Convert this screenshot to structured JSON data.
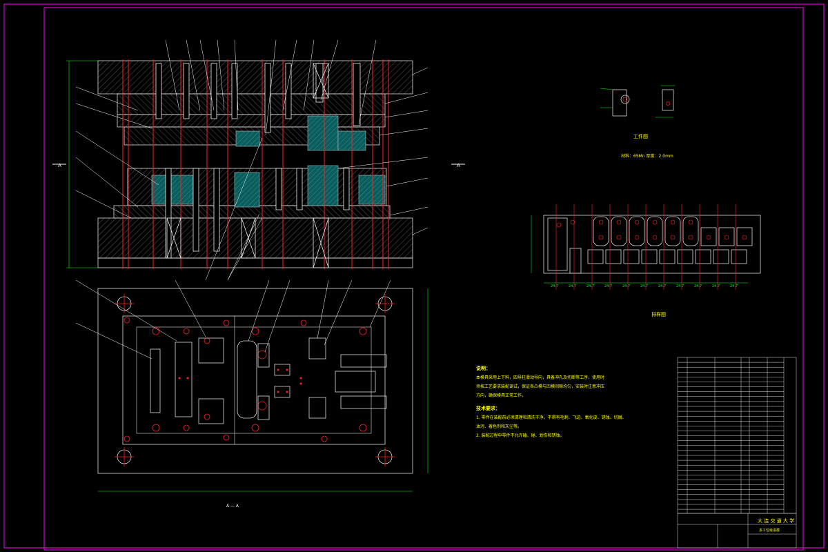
{
  "drawing": {
    "workpiece_caption": "工件图",
    "material_caption": "材料：65Mn  厚度：2.0mm",
    "strip_caption": "排样图",
    "pitch_labels": [
      "24.7",
      "24.7",
      "24.7",
      "24.7",
      "24.7",
      "24.7",
      "24.7",
      "24.7",
      "24.7",
      "24.7",
      "24.7"
    ],
    "main_view_label": "A — A",
    "section_mark_left": "A",
    "section_mark_right": "A"
  },
  "notes": {
    "desc_title": "说明：",
    "desc_line1": "本模具采用上下料，四导柱滑动导向，具备冲孔及切断等工序，使用时",
    "desc_line2": "须按工艺要求装配调试，保证各凸模与凹模间隙均匀，安装时注意冲压",
    "desc_line3": "方向，确保模具正常工作。",
    "tech_title": "技术要求：",
    "tech_line1": "1. 零件在装配前必须清理和清洗干净，不得有毛刺、飞边、氧化皮、锈蚀、切屑、",
    "tech_line2": "   油污、着色剂和灰尘等。",
    "tech_line3": "2. 装配过程中零件不允许磕、碰、划伤和锈蚀。"
  },
  "title_block": {
    "school": "大 连 交 通 大 学",
    "drawing_name": "多工位级进模"
  }
}
